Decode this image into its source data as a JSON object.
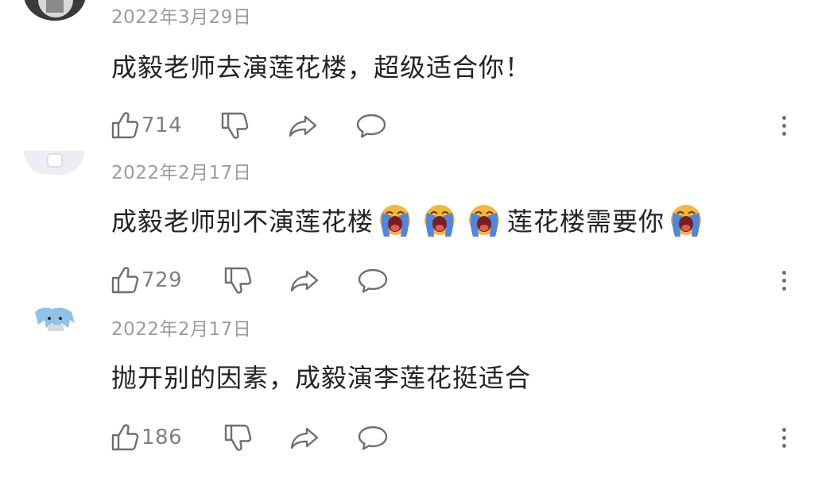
{
  "colors": {
    "background": "#ffffff",
    "text": "#232323",
    "meta": "#9b9b9b",
    "icon": "#6f6f6f"
  },
  "comments": [
    {
      "date": "2022年3月29日",
      "text_parts": [
        "成毅老师去演莲花楼，超级适合你！"
      ],
      "emoji_icon": "loudly-crying-face-emoji",
      "likes": "714"
    },
    {
      "date": "2022年2月17日",
      "text_parts": [
        "成毅老师别不演莲花楼",
        "莲花楼需要你"
      ],
      "emoji_icon": "loudly-crying-face-emoji",
      "likes": "729"
    },
    {
      "date": "2022年2月17日",
      "text_parts": [
        "抛开别的因素，成毅演李莲花挺适合"
      ],
      "emoji_icon": "loudly-crying-face-emoji",
      "likes": "186"
    }
  ]
}
